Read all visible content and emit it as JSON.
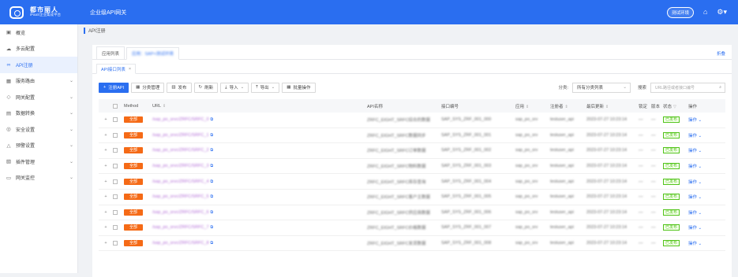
{
  "header": {
    "logo_main": "都市丽人",
    "logo_sub": "iPaaS企业集成平台",
    "app_title": "企业级API网关",
    "env_badge": "测试环境",
    "icons": [
      "home-icon",
      "user-menu-icon"
    ]
  },
  "sidebar": {
    "items": [
      {
        "label": "概览",
        "icon": "overview-icon",
        "has_chevron": false
      },
      {
        "label": "多云配置",
        "icon": "cloud-icon",
        "has_chevron": false
      },
      {
        "label": "API注册",
        "icon": "link-icon",
        "has_chevron": false,
        "active": true
      },
      {
        "label": "服务路由",
        "icon": "route-icon",
        "has_chevron": true
      },
      {
        "label": "网关配置",
        "icon": "tag-icon",
        "has_chevron": true
      },
      {
        "label": "数据转换",
        "icon": "convert-icon",
        "has_chevron": true
      },
      {
        "label": "安全设置",
        "icon": "shield-icon",
        "has_chevron": true
      },
      {
        "label": "预警设置",
        "icon": "warning-icon",
        "has_chevron": true
      },
      {
        "label": "插件管理",
        "icon": "plugin-icon",
        "has_chevron": true
      },
      {
        "label": "网关监控",
        "icon": "monitor-icon",
        "has_chevron": true
      }
    ]
  },
  "breadcrumb": "API注册",
  "tabs_top": {
    "items": [
      "应用列表",
      "应用：SAP+测试环境"
    ],
    "collapse": "折叠"
  },
  "tabs_sub": {
    "label": "API接口列表",
    "close": "×"
  },
  "toolbar": {
    "register": "注册API",
    "category": "分类管理",
    "publish": "发布",
    "refresh": "刷新",
    "import": "导入",
    "export": "导出",
    "batch": "批量操作",
    "category_label": "分类:",
    "category_value": "所有分类列表",
    "search_label": "搜索",
    "search_placeholder": "URL路径或者接口编号"
  },
  "table": {
    "headers": {
      "method": "Method",
      "url": "URL",
      "api_name": "API名称",
      "code": "接口编号",
      "app": "应用",
      "registrant": "注册者",
      "updated": "最后更新",
      "lock": "锁定",
      "version": "版本",
      "status": "状态",
      "operation": "操作"
    },
    "rows": [
      {
        "method": "全部",
        "url": "/sap_po_srvc/ZRFC/SRFC_0",
        "api": "ZRFC_EIGHT_SRFC综合的数据",
        "code": "SAP_SYS_ZRF_001_000",
        "app": "sap_po_srv",
        "reg": "testuser_api",
        "upd": "2023-07-27 10:23:14",
        "status": "已发布",
        "op": "操作"
      },
      {
        "method": "全部",
        "url": "/sap_po_srvc/ZRFC/SRFC_1",
        "api": "ZRFC_EIGHT_SRFC数据同步",
        "code": "SAP_SYS_ZRF_001_001",
        "app": "sap_po_srv",
        "reg": "testuser_api",
        "upd": "2023-07-27 10:23:14",
        "status": "已发布",
        "op": "操作"
      },
      {
        "method": "全部",
        "url": "/sap_po_srvc/ZRFC/SRFC_2",
        "api": "ZRFC_EIGHT_SRFC订单数据",
        "code": "SAP_SYS_ZRF_001_002",
        "app": "sap_po_srv",
        "reg": "testuser_api",
        "upd": "2023-07-27 10:23:14",
        "status": "已发布",
        "op": "操作"
      },
      {
        "method": "全部",
        "url": "/sap_po_srvc/ZRFC/SRFC_3",
        "api": "ZRFC_EIGHT_SRFC物料数据",
        "code": "SAP_SYS_ZRF_001_003",
        "app": "sap_po_srv",
        "reg": "testuser_api",
        "upd": "2023-07-27 10:23:14",
        "status": "已发布",
        "op": "操作"
      },
      {
        "method": "全部",
        "url": "/sap_po_srvc/ZRFC/SRFC_4",
        "api": "ZRFC_EIGHT_SRFC库存查询",
        "code": "SAP_SYS_ZRF_001_004",
        "app": "sap_po_srv",
        "reg": "testuser_api",
        "upd": "2023-07-27 10:23:14",
        "status": "已发布",
        "op": "操作"
      },
      {
        "method": "全部",
        "url": "/sap_po_srvc/ZRFC/SRFC_5",
        "api": "ZRFC_EIGHT_SRFC客户主数据",
        "code": "SAP_SYS_ZRF_001_005",
        "app": "sap_po_srv",
        "reg": "testuser_api",
        "upd": "2023-07-27 10:23:14",
        "status": "已发布",
        "op": "操作"
      },
      {
        "method": "全部",
        "url": "/sap_po_srvc/ZRFC/SRFC_6",
        "api": "ZRFC_EIGHT_SRFC供应商数据",
        "code": "SAP_SYS_ZRF_001_006",
        "app": "sap_po_srv",
        "reg": "testuser_api",
        "upd": "2023-07-27 10:23:14",
        "status": "已发布",
        "op": "操作"
      },
      {
        "method": "全部",
        "url": "/sap_po_srvc/ZRFC/SRFC_7",
        "api": "ZRFC_EIGHT_SRFC价格数据",
        "code": "SAP_SYS_ZRF_001_007",
        "app": "sap_po_srv",
        "reg": "testuser_api",
        "upd": "2023-07-27 10:23:14",
        "status": "已发布",
        "op": "操作"
      },
      {
        "method": "全部",
        "url": "/sap_po_srvc/ZRFC/SRFC_8",
        "api": "ZRFC_EIGHT_SRFC发货数据",
        "code": "SAP_SYS_ZRF_001_008",
        "app": "sap_po_srv",
        "reg": "testuser_api",
        "upd": "2023-07-27 10:23:14",
        "status": "已发布",
        "op": "操作"
      }
    ]
  },
  "colors": {
    "primary": "#2a6ef0",
    "method_badge": "#f56a16",
    "status_ok": "#52c41a"
  }
}
